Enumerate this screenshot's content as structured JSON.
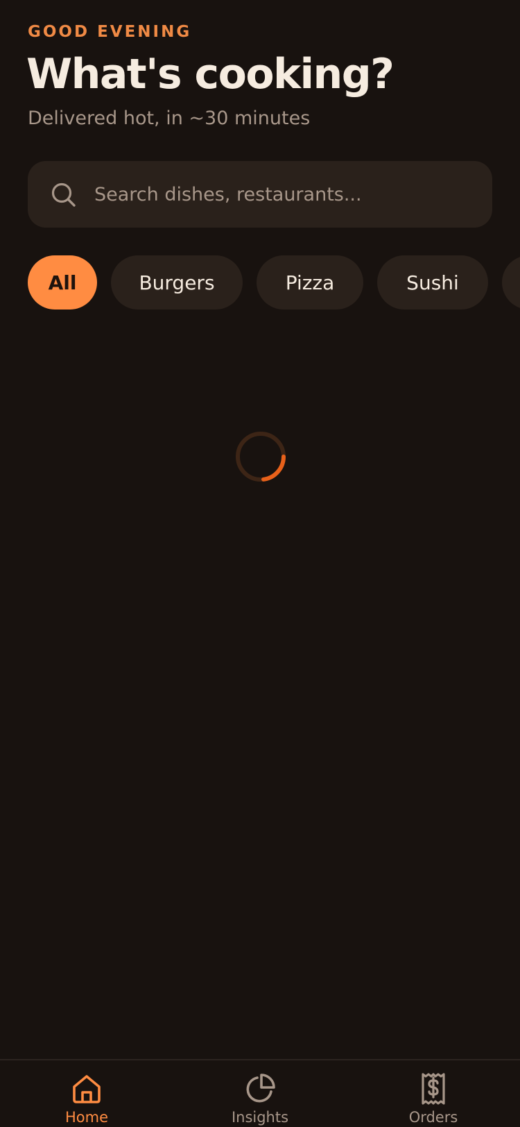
{
  "header": {
    "greeting": "GOOD EVENING",
    "title": "What's cooking?",
    "subtitle": "Delivered hot, in ~30 minutes"
  },
  "search": {
    "placeholder": "Search dishes, restaurants...",
    "value": "",
    "icon": "search-icon"
  },
  "categories": {
    "selected": "All",
    "items": [
      {
        "label": "All"
      },
      {
        "label": "Burgers"
      },
      {
        "label": "Pizza"
      },
      {
        "label": "Sushi"
      },
      {
        "label": ""
      }
    ]
  },
  "loading": {
    "spinner_icon": "loading-spinner-icon"
  },
  "tabbar": {
    "items": [
      {
        "label": "Home",
        "icon": "home-icon",
        "active": true
      },
      {
        "label": "Insights",
        "icon": "pie-chart-icon",
        "active": false
      },
      {
        "label": "Orders",
        "icon": "receipt-icon",
        "active": false
      }
    ]
  },
  "colors": {
    "background": "#18120f",
    "surface": "#2a211b",
    "accent": "#ff8c42",
    "text_primary": "#f6ece0",
    "text_secondary": "#a8978a"
  }
}
